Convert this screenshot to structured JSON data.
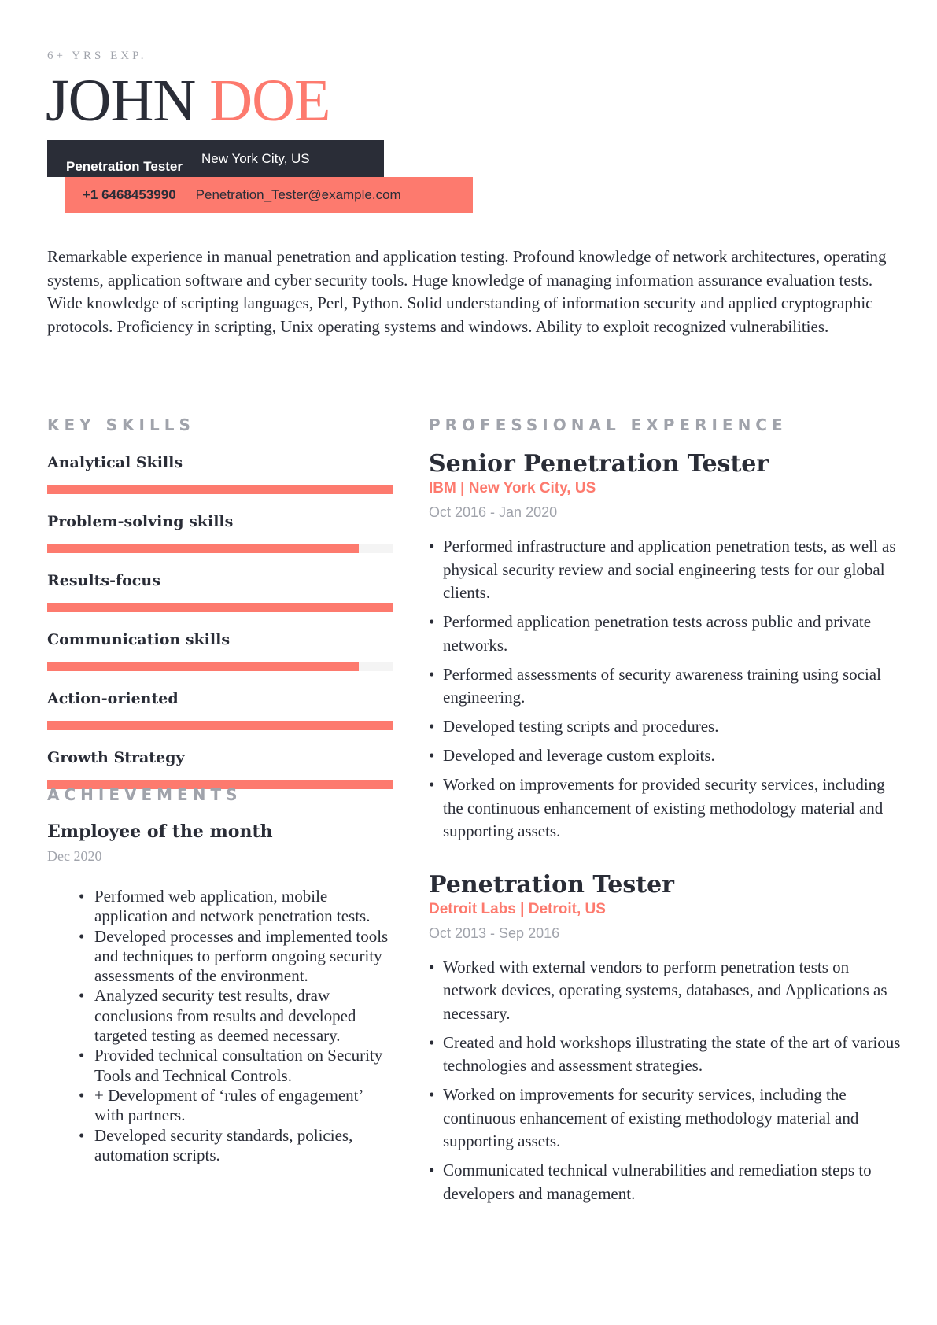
{
  "header": {
    "experience_tag": "6+ YRS EXP.",
    "first_name": "JOHN",
    "last_name": "DOE",
    "job_title": "Penetration Tester",
    "location": "New York City, US",
    "phone": "+1 6468453990",
    "email": "Penetration_Tester@example.com"
  },
  "colors": {
    "accent": "#fd7a6e",
    "dark": "#2a2d37",
    "muted": "#a0a3ab",
    "track": "#f4f4f4"
  },
  "summary": "Remarkable experience in manual penetration and application testing. Profound knowledge of network architectures, operating systems, application software and cyber security tools. Huge knowledge of managing information assurance evaluation tests. Wide knowledge of scripting languages, Perl, Python. Solid understanding of information security and applied cryptographic protocols. Proficiency in scripting, Unix operating systems and windows. Ability to exploit recognized vulnerabilities.",
  "skills": {
    "title": "KEY  SKILLS",
    "items": [
      {
        "name": "Analytical Skills",
        "level": 1.0
      },
      {
        "name": "Problem-solving skills",
        "level": 0.9
      },
      {
        "name": "Results-focus",
        "level": 1.0
      },
      {
        "name": "Communication skills",
        "level": 0.9
      },
      {
        "name": "Action-oriented",
        "level": 1.0
      },
      {
        "name": "Growth Strategy",
        "level": 1.0
      }
    ]
  },
  "achievements": {
    "title": "ACHIEVEMENTS",
    "items": [
      {
        "title": "Employee of the month",
        "date": "Dec 2020",
        "bullets": [
          "Performed web application, mobile application and network penetration tests.",
          "Developed processes and implemented tools and techniques to perform ongoing security assessments of the environment.",
          "Analyzed security test results, draw conclusions from results and developed targeted testing as deemed necessary.",
          "Provided technical consultation on Security Tools and Technical Controls.",
          "+ Development of ‘rules of engagement’ with partners.",
          "Developed security standards, policies, automation scripts."
        ]
      }
    ]
  },
  "experience": {
    "title": "PROFESSIONAL  EXPERIENCE",
    "jobs": [
      {
        "title": "Senior Penetration Tester",
        "company": "IBM | New York City, US",
        "dates": "Oct 2016 - Jan 2020",
        "bullets": [
          "Performed infrastructure and application penetration tests, as well as physical security review and social engineering tests for our global clients.",
          "Performed application penetration tests across public and private networks.",
          "Performed assessments of security awareness training using social engineering.",
          "Developed testing scripts and procedures.",
          "Developed and leverage custom exploits.",
          "Worked on improvements for provided security services, including the continuous enhancement of existing methodology material and supporting assets."
        ]
      },
      {
        "title": "Penetration Tester",
        "company": "Detroit Labs | Detroit, US",
        "dates": "Oct 2013 - Sep 2016",
        "bullets": [
          "Worked with external vendors to perform penetration tests on network devices, operating systems, databases, and Applications as necessary.",
          "Created and hold workshops illustrating the state of the art of various technologies and assessment strategies.",
          "Worked on improvements for security services, including the continuous enhancement of existing methodology material and supporting assets.",
          "Communicated technical vulnerabilities and remediation steps to developers and management."
        ]
      }
    ]
  }
}
